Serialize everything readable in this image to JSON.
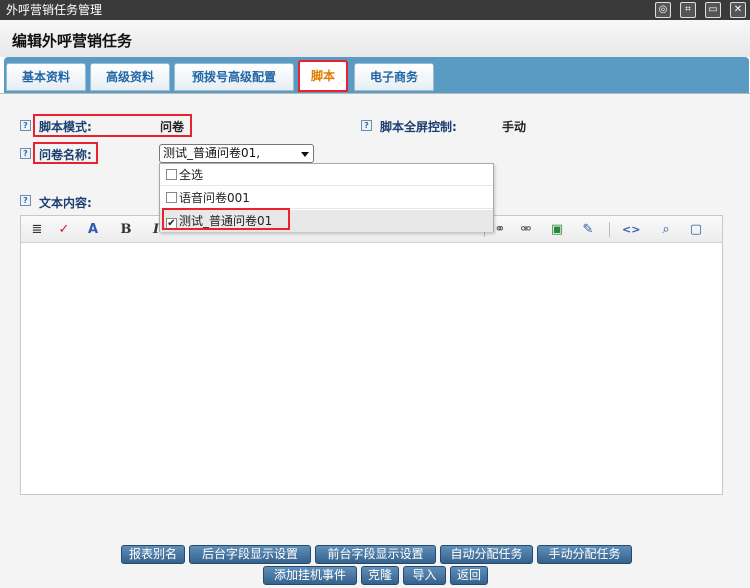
{
  "window": {
    "title": "外呼营销任务管理",
    "buttons": [
      "◎",
      "⌗",
      "▭",
      "✕"
    ]
  },
  "page": {
    "title": "编辑外呼营销任务"
  },
  "tabs": [
    {
      "label": "基本资料",
      "active": false
    },
    {
      "label": "高级资料",
      "active": false
    },
    {
      "label": "预拨号高级配置",
      "active": false
    },
    {
      "label": "脚本",
      "active": true
    },
    {
      "label": "电子商务",
      "active": false
    }
  ],
  "form": {
    "help_glyph": "?",
    "script_mode_label": "脚本模式:",
    "script_mode_value": "问卷",
    "fullscreen_label": "脚本全屏控制:",
    "fullscreen_value": "手动",
    "questionnaire_label": "问卷名称:",
    "questionnaire_selected": "测试_普通问卷01,",
    "text_content_label": "文本内容:"
  },
  "dropdown": {
    "items": [
      {
        "label": "全选",
        "checked": false
      },
      {
        "label": "语音问卷001",
        "checked": false
      },
      {
        "label": "测试_普通问卷01",
        "checked": true
      }
    ],
    "check_mark": "✔"
  },
  "toolbar": {
    "icons": [
      {
        "name": "format-icon",
        "glyph": "≣"
      },
      {
        "name": "spellcheck-icon",
        "glyph": "✓"
      },
      {
        "name": "font-color-icon",
        "glyph": "A"
      },
      {
        "name": "bold-icon",
        "glyph": "B"
      },
      {
        "name": "italic-icon",
        "glyph": "I"
      },
      {
        "name": "link-icon",
        "glyph": "⚭"
      },
      {
        "name": "unlink-icon",
        "glyph": "⚮"
      },
      {
        "name": "image-icon",
        "glyph": "▣"
      },
      {
        "name": "edit-icon",
        "glyph": "✎"
      },
      {
        "name": "source-code-icon",
        "glyph": "<>"
      },
      {
        "name": "preview-icon",
        "glyph": "⌕"
      },
      {
        "name": "fullscreen-icon",
        "glyph": "▢"
      }
    ]
  },
  "actions": {
    "row1": [
      "报表别名",
      "后台字段显示设置",
      "前台字段显示设置",
      "自动分配任务",
      "手动分配任务"
    ],
    "row2": [
      "添加挂机事件",
      "克隆",
      "导入",
      "返回"
    ]
  }
}
